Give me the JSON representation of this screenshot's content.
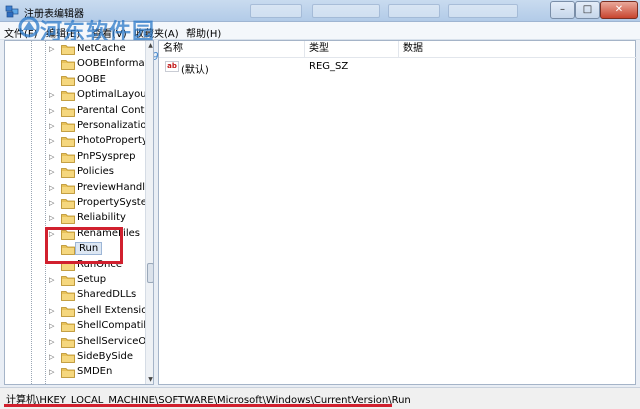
{
  "window": {
    "title": "注册表编辑器",
    "minimize": "–",
    "maximize": "□",
    "close": "✕"
  },
  "watermark": {
    "text": "河东软件园",
    "url": "www.pc0359.cn"
  },
  "menu": [
    "文件(F)",
    "编辑(E)",
    "查看(V)",
    "收藏夹(A)",
    "帮助(H)"
  ],
  "tree": {
    "items": [
      {
        "label": "NetCache",
        "expandable": true
      },
      {
        "label": "OOBEInformati",
        "expandable": false
      },
      {
        "label": "OOBE",
        "expandable": false
      },
      {
        "label": "OptimalLayout",
        "expandable": true
      },
      {
        "label": "Parental Contr",
        "expandable": true
      },
      {
        "label": "Personalization",
        "expandable": true
      },
      {
        "label": "PhotoProperty",
        "expandable": true
      },
      {
        "label": "PnPSysprep",
        "expandable": true
      },
      {
        "label": "Policies",
        "expandable": true
      },
      {
        "label": "PreviewHandle",
        "expandable": true
      },
      {
        "label": "PropertySyster",
        "expandable": true
      },
      {
        "label": "Reliability",
        "expandable": true
      },
      {
        "label": "RenameFiles",
        "expandable": true
      },
      {
        "label": "Run",
        "expandable": false,
        "selected": true
      },
      {
        "label": "RunOnce",
        "expandable": false
      },
      {
        "label": "Setup",
        "expandable": true
      },
      {
        "label": "SharedDLLs",
        "expandable": false
      },
      {
        "label": "Shell Extension",
        "expandable": true
      },
      {
        "label": "ShellCompatib",
        "expandable": true
      },
      {
        "label": "ShellServiceOb",
        "expandable": true
      },
      {
        "label": "SideBySide",
        "expandable": true
      },
      {
        "label": "SMDEn",
        "expandable": true
      }
    ]
  },
  "values": {
    "columns": [
      "名称",
      "类型",
      "数据"
    ],
    "rows": [
      {
        "icon": "ab",
        "name": "(默认)",
        "type": "REG_SZ",
        "data": ""
      }
    ]
  },
  "status": {
    "path": "计算机\\HKEY_LOCAL_MACHINE\\SOFTWARE\\Microsoft\\Windows\\CurrentVersion\\Run"
  },
  "colors": {
    "highlight_box": "#d1202e",
    "folder": "#e8c25a"
  }
}
